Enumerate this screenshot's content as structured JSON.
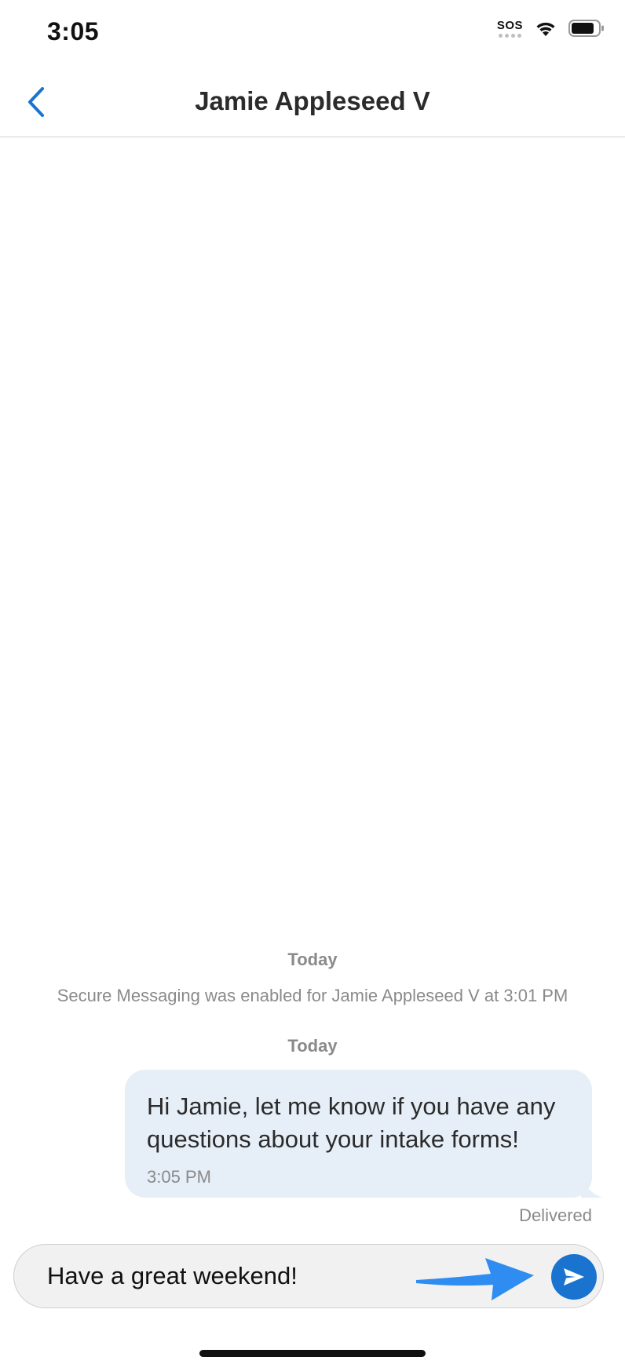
{
  "status_bar": {
    "time": "3:05",
    "sos": "SOS"
  },
  "nav": {
    "title": "Jamie Appleseed V",
    "back_icon": "chevron-left-icon"
  },
  "conversation": {
    "day_label_1": "Today",
    "system_message": "Secure Messaging was enabled for Jamie Appleseed V at 3:01 PM",
    "day_label_2": "Today",
    "messages": [
      {
        "text": "Hi Jamie, let me know if you have any questions about your intake forms!",
        "time": "3:05 PM"
      }
    ],
    "delivered_status": "Delivered"
  },
  "composer": {
    "value": "Have a great weekend!",
    "send_icon": "send-icon"
  },
  "colors": {
    "accent": "#1a73cf",
    "bubble": "#e6eef7",
    "annotation_arrow": "#2f8cf0"
  }
}
